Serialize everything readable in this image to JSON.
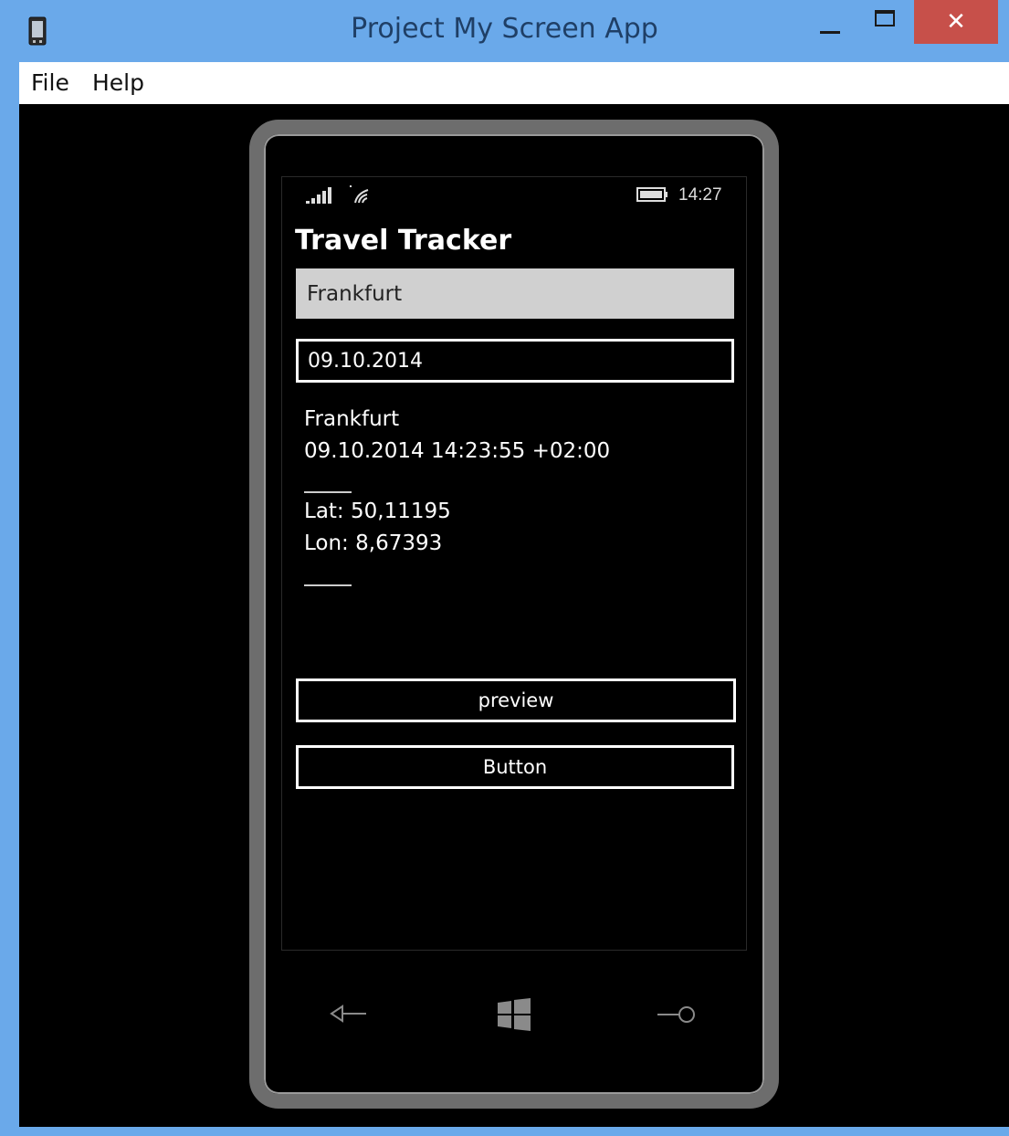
{
  "window": {
    "title": "Project My Screen App",
    "close_symbol": "✕"
  },
  "menu": {
    "items": [
      "File",
      "Help"
    ]
  },
  "phone": {
    "status": {
      "time": "14:27"
    },
    "app_title": "Travel Tracker",
    "city_value": "Frankfurt",
    "date_value": "09.10.2014",
    "info": {
      "city": "Frankfurt",
      "timestamp": "09.10.2014 14:23:55 +02:00",
      "lat": "Lat: 50,11195",
      "lon": "Lon: 8,67393"
    },
    "buttons": {
      "preview_label": "preview",
      "button_label": "Button"
    },
    "hardware_keys": [
      "back-icon",
      "windows-start-icon",
      "search-icon"
    ]
  },
  "colors": {
    "titlebar": "#6aa9ea",
    "close_button": "#c7504a",
    "phone_frame": "#6d6d6d",
    "input_fill": "#d0d0d0"
  }
}
